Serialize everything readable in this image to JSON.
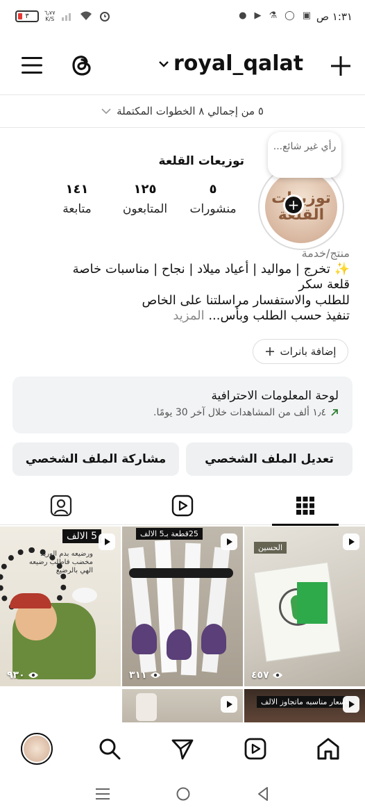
{
  "status_bar": {
    "time": "١:٣١ ص",
    "battery": "٣",
    "net_speed_value": "٦٫٧٧",
    "net_speed_unit": "K/S"
  },
  "header": {
    "username": "royal_qalat"
  },
  "steps_banner": {
    "text": "٥ من إجمالي ٨ الخطوات المكتملة"
  },
  "profile": {
    "note": "رأي غير شائع...",
    "avatar_text": "توزيعات القلعة",
    "display_name": "توزيعات القلعة",
    "stats": [
      {
        "number": "٥",
        "label": "منشورات"
      },
      {
        "number": "١٢٥",
        "label": "المتابعون"
      },
      {
        "number": "١٤١",
        "label": "متابعة"
      }
    ],
    "category": "منتج/خدمة",
    "bio_lines": [
      "✨ تخرج | مواليد | أعياد ميلاد | نجاح | مناسبات خاصة",
      "قلعة سكر",
      "للطلب والاستفسار مراسلتنا على الخاص"
    ],
    "bio_last": "تنفيذ حسب الطلب وبأس...",
    "more_label": "المزيد",
    "add_banners_label": "إضافة بانرات"
  },
  "dashboard": {
    "title": "لوحة المعلومات الاحترافية",
    "subtitle": "١٫٤ ألف من المشاهدات خلال آخر 30 يومًا."
  },
  "buttons": {
    "edit_profile": "تعديل الملف الشخصي",
    "share_profile": "مشاركة الملف الشخصي"
  },
  "grid": {
    "tiles": [
      {
        "views": "٤٥٧",
        "caption": "الحسين"
      },
      {
        "views": "٣١١",
        "caption": "25قطعة بـ5 الالف"
      },
      {
        "views": "٩٣٠",
        "caption": "5 الالف",
        "caption2": "ورضيعه بدم الوريد مخضب فاطلب رضيعه الهي بالرضيع"
      },
      {
        "views": "",
        "caption": ""
      },
      {
        "views": "",
        "caption": "باسعار مناسبه ماتجاوز الالف"
      }
    ]
  },
  "colors": {
    "accent_green": "#2e7d32",
    "bubble_bg": "#ffffff",
    "button_bg": "#eef0f2"
  }
}
